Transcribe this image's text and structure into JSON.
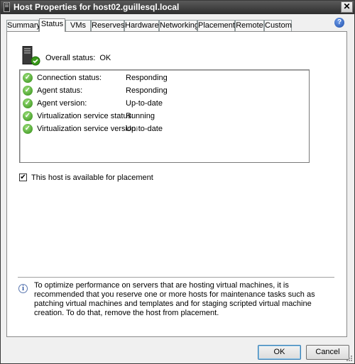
{
  "window": {
    "title": "Host Properties for host02.guillesql.local",
    "close_symbol": "✕"
  },
  "tabs": [
    {
      "label": "Summary",
      "active": false
    },
    {
      "label": "Status",
      "active": true
    },
    {
      "label": "VMs",
      "active": false
    },
    {
      "label": "Reserves",
      "active": false
    },
    {
      "label": "Hardware",
      "active": false
    },
    {
      "label": "Networking",
      "active": false
    },
    {
      "label": "Placement",
      "active": false
    },
    {
      "label": "Remote",
      "active": false
    },
    {
      "label": "Custom",
      "active": false
    }
  ],
  "help": {
    "symbol": "?",
    "icon": "help-icon"
  },
  "status": {
    "overall_label": "Overall status:",
    "overall_value": "OK",
    "rows": [
      {
        "label": "Connection status:",
        "value": "Responding",
        "icon": "ok-check-icon"
      },
      {
        "label": "Agent status:",
        "value": "Responding",
        "icon": "ok-check-icon"
      },
      {
        "label": "Agent version:",
        "value": "Up-to-date",
        "icon": "ok-check-icon"
      },
      {
        "label": "Virtualization service status:",
        "value": "Running",
        "icon": "ok-check-icon"
      },
      {
        "label": "Virtualization service version:",
        "value": "Up-to-date",
        "icon": "ok-check-icon"
      }
    ]
  },
  "placement_checkbox": {
    "label": "This host is available for placement",
    "checked": true,
    "check_symbol": "✔"
  },
  "info": {
    "symbol": "i",
    "text": "To optimize performance on servers that are hosting virtual machines, it is recommended that you reserve one or more hosts for maintenance tasks such as patching virtual machines and templates and for staging scripted virtual machine creation. To do that, remove the host from placement."
  },
  "buttons": {
    "ok_label": "OK",
    "cancel_label": "Cancel"
  },
  "colors": {
    "titlebar": "#3c3c3c",
    "ok_green": "#2e8a12",
    "help_blue": "#1f4fa8"
  }
}
